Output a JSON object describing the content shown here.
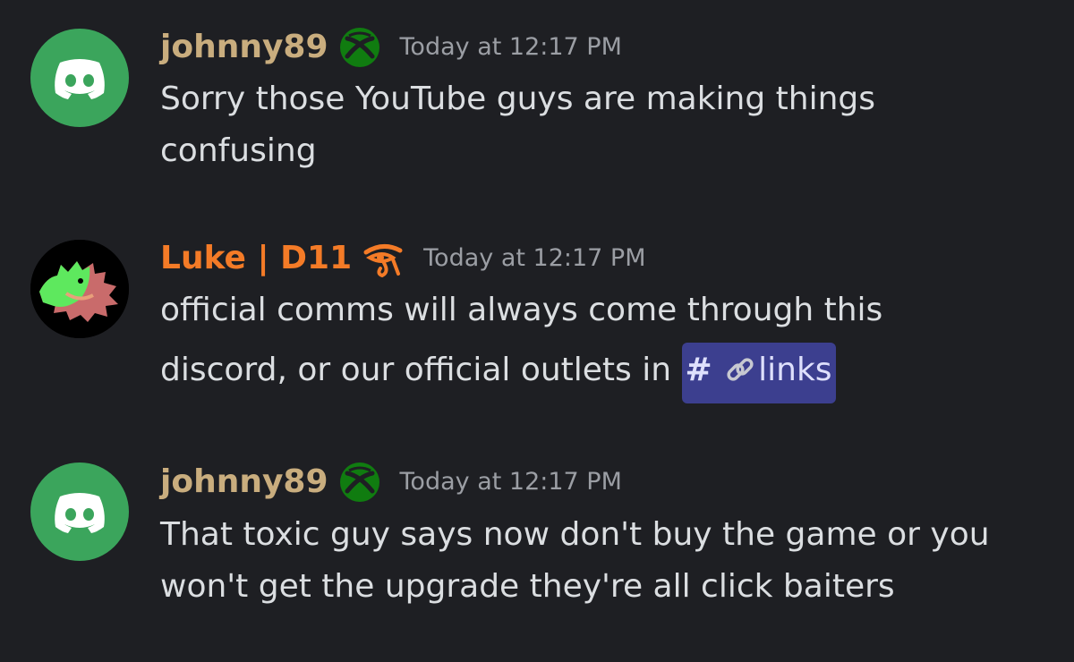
{
  "colors": {
    "background": "#1e1f23",
    "message_text": "#dbdee1",
    "timestamp": "#9b9ea4",
    "johnny_name": "#c9ad7e",
    "luke_name": "#f47b27",
    "discord_green": "#3ba55c",
    "xbox_green": "#107c10",
    "mention_bg": "#3c3f8f"
  },
  "messages": [
    {
      "author": "johnny89",
      "badge_icon": "xbox-icon",
      "timestamp": "Today at 12:17 PM",
      "avatar": "discord-default-avatar",
      "lines": [
        "Sorry those YouTube guys are making things",
        "confusing"
      ]
    },
    {
      "author": "Luke | D11",
      "badge_icon": "eye-of-horus-icon",
      "timestamp": "Today at 12:17 PM",
      "avatar": "custom-avatar",
      "line1": "official comms will always come through this",
      "line2_prefix": "discord, or our official outlets in",
      "channel_mention": {
        "hash": "#",
        "icon": "link-icon",
        "name": "links"
      }
    },
    {
      "author": "johnny89",
      "badge_icon": "xbox-icon",
      "timestamp": "Today at 12:17 PM",
      "avatar": "discord-default-avatar",
      "lines": [
        "That toxic guy says now don't buy the game or you",
        "won't get the upgrade they're all click baiters"
      ]
    }
  ]
}
